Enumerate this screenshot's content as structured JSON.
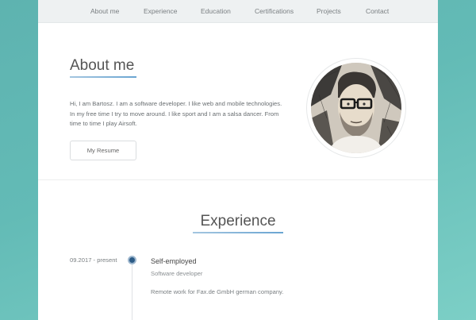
{
  "nav": {
    "items": [
      {
        "label": "About me"
      },
      {
        "label": "Experience"
      },
      {
        "label": "Education"
      },
      {
        "label": "Certifications"
      },
      {
        "label": "Projects"
      },
      {
        "label": "Contact"
      }
    ]
  },
  "about": {
    "title": "About me",
    "text": "Hi, I am Bartosz. I am a software developer. I like web and mobile technologies. In my free time I try to move around. I like sport and I am a salsa dancer. From time to time I play Airsoft.",
    "resume_button": "My Resume"
  },
  "experience": {
    "title": "Experience",
    "entries": [
      {
        "date": "09.2017 - present",
        "role": "Self-employed",
        "position": "Software developer",
        "description": "Remote work for Fax.de GmbH german company."
      }
    ]
  },
  "colors": {
    "accent": "#6aa5d2",
    "timeline_dot": "#2c5b86",
    "background_teal": "#63bbb6"
  },
  "icons": {
    "profile_photo": "sketch-portrait-avatar"
  }
}
